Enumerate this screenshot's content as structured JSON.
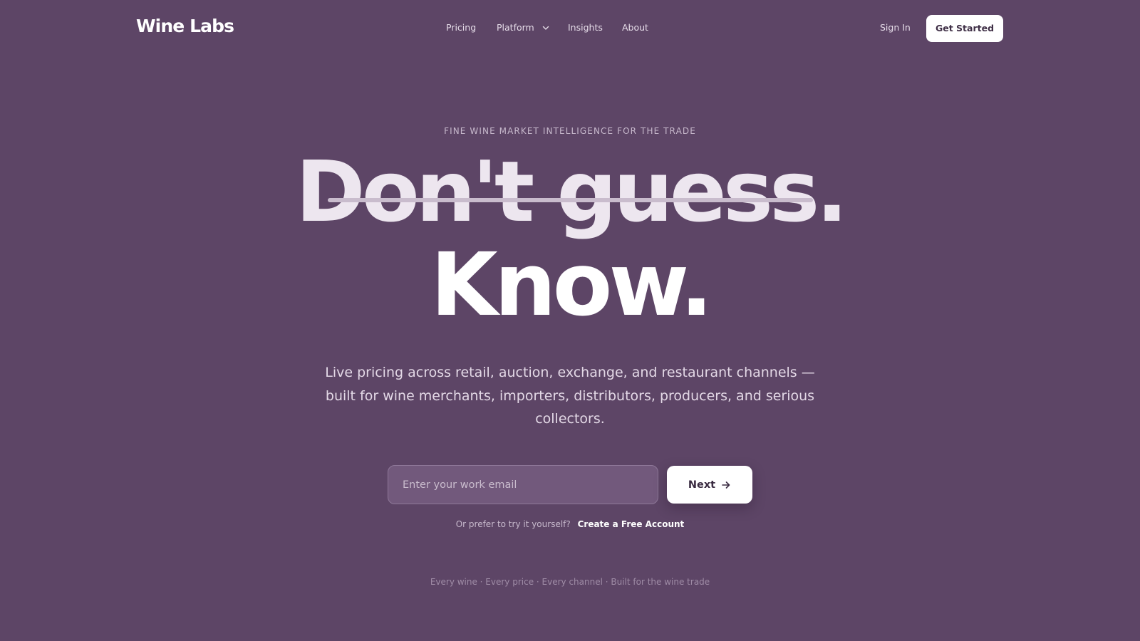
{
  "header": {
    "logo": "Wine Labs",
    "nav": {
      "pricing": "Pricing",
      "platform": "Platform",
      "insights": "Insights",
      "about": "About"
    },
    "sign_in": "Sign In",
    "get_started": "Get Started"
  },
  "hero": {
    "eyebrow": "FINE WINE MARKET INTELLIGENCE FOR THE TRADE",
    "headline_struck": "Don't guess.",
    "headline_main": "Know.",
    "subtitle": "Live pricing across retail, auction, exchange, and restaurant channels — built for wine merchants, importers, distributors, producers, and serious collectors."
  },
  "form": {
    "email_placeholder": "Enter your work email",
    "email_value": "",
    "next_label": "Next",
    "alt_prompt": "Or prefer to try it yourself?",
    "alt_link": "Create a Free Account"
  },
  "footer": {
    "tagline": "Every wine · Every price · Every channel · Built for the wine trade"
  },
  "colors": {
    "background": "#5d4566",
    "button_bg": "#ffffff",
    "button_text": "#3a2b41",
    "input_bg": "#72597c"
  },
  "icons": {
    "platform_dropdown": "chevron-down-icon",
    "next": "arrow-right-icon"
  }
}
